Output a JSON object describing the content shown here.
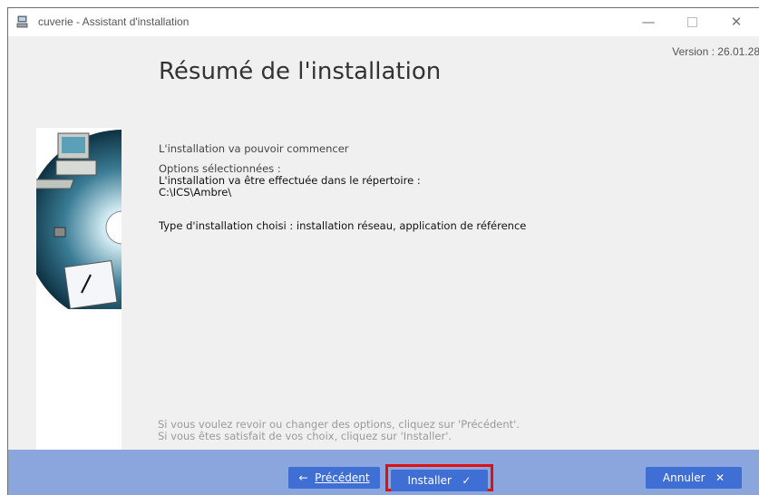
{
  "window": {
    "title": "cuverie - Assistant d'installation",
    "version": "Version : 26.01.28"
  },
  "controls": {
    "minimize": "—",
    "maximize": "□",
    "close": "✕"
  },
  "summary": {
    "heading": "Résumé de l'installation",
    "intro": "L'installation va pouvoir commencer",
    "options_label": "Options sélectionnées :",
    "directory_line": "L'installation va être effectuée dans le répertoire :",
    "directory_path": "C:\\ICS\\Ambre\\",
    "type_line": "Type d'installation choisi : installation réseau, application de référence",
    "hint_back": "Si vous voulez revoir ou changer des options, cliquez sur 'Précédent'.",
    "hint_install": "Si vous êtes satisfait de vos choix, cliquez sur 'Installer'."
  },
  "buttons": {
    "prev_arrow": "←",
    "prev_label": "Précédent",
    "install_label": "Installer",
    "install_icon": "✓",
    "cancel_label": "Annuler",
    "cancel_icon": "✕"
  },
  "colors": {
    "footer": "#8aa6dd",
    "button": "#3f6fd4",
    "highlight": "#e01010",
    "panel": "#f0f0f0"
  }
}
